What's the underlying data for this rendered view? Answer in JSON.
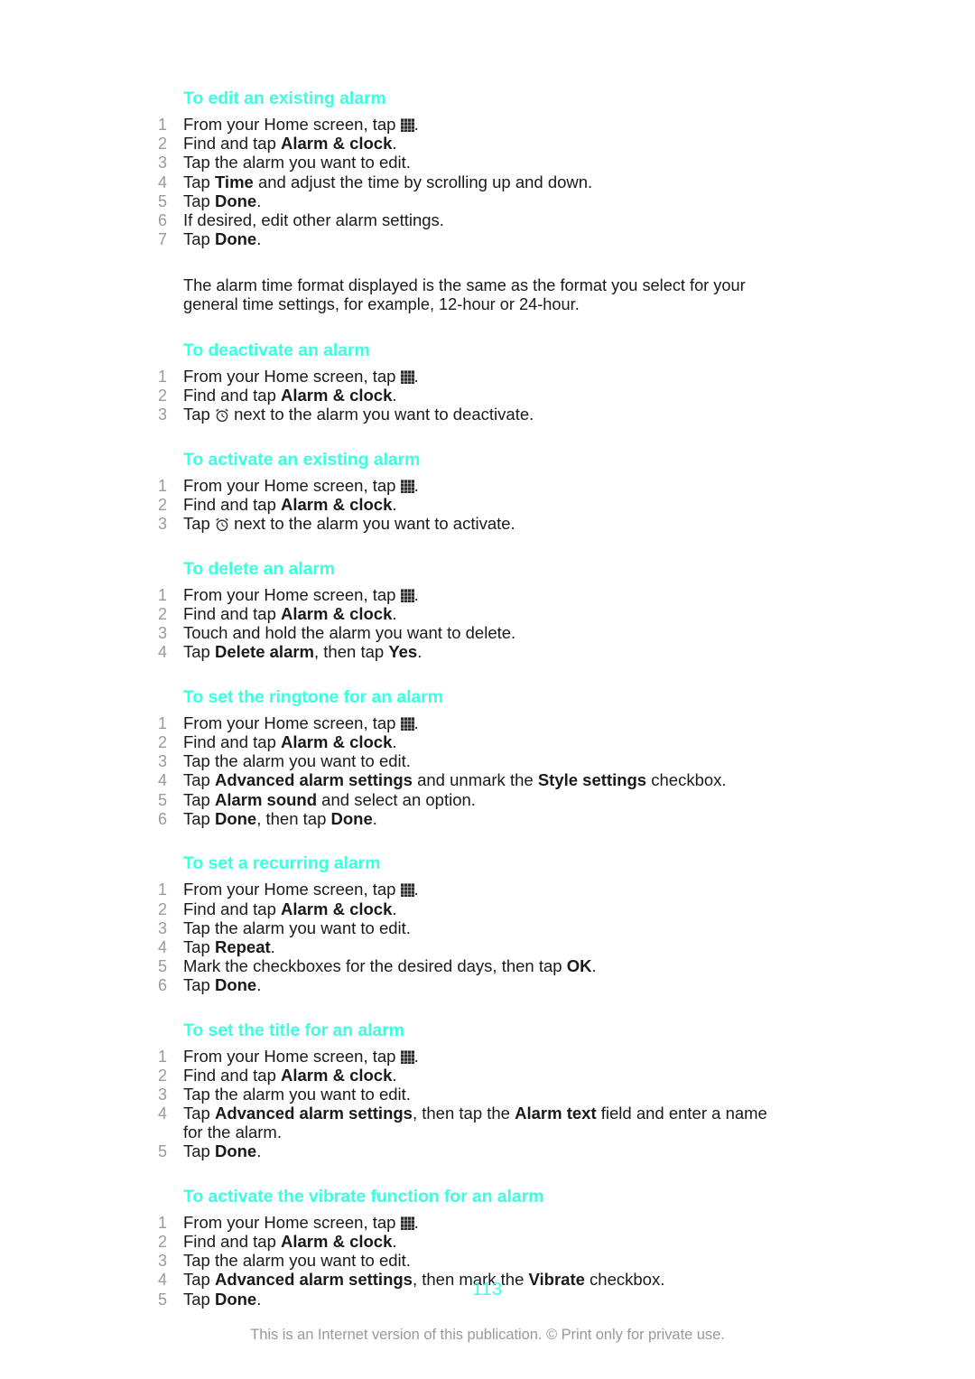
{
  "document": {
    "page_number": "113",
    "footer_note": "This is an Internet version of this publication. © Print only for private use.",
    "accent_color": "#3dffe0",
    "number_color": "#9a9a9a",
    "text_color": "#1a1a1a"
  },
  "icons": {
    "app_drawer": "app-drawer-icon",
    "alarm_clock": "alarm-clock-icon"
  },
  "sections": [
    {
      "heading": "To edit an existing alarm",
      "steps": [
        {
          "num": "1",
          "parts": [
            {
              "t": "From your Home screen, tap "
            },
            {
              "icon": "app-drawer"
            },
            {
              "t": "."
            }
          ]
        },
        {
          "num": "2",
          "parts": [
            {
              "t": "Find and tap "
            },
            {
              "t": "Alarm & clock",
              "bold": true
            },
            {
              "t": "."
            }
          ]
        },
        {
          "num": "3",
          "parts": [
            {
              "t": "Tap the alarm you want to edit."
            }
          ]
        },
        {
          "num": "4",
          "parts": [
            {
              "t": "Tap "
            },
            {
              "t": "Time",
              "bold": true
            },
            {
              "t": " and adjust the time by scrolling up and down."
            }
          ]
        },
        {
          "num": "5",
          "parts": [
            {
              "t": "Tap "
            },
            {
              "t": "Done",
              "bold": true
            },
            {
              "t": "."
            }
          ]
        },
        {
          "num": "6",
          "parts": [
            {
              "t": "If desired, edit other alarm settings."
            }
          ]
        },
        {
          "num": "7",
          "parts": [
            {
              "t": "Tap "
            },
            {
              "t": "Done",
              "bold": true
            },
            {
              "t": "."
            }
          ]
        }
      ],
      "note": "The alarm time format displayed is the same as the format you select for your general time settings, for example, 12-hour or 24-hour."
    },
    {
      "heading": "To deactivate an alarm",
      "steps": [
        {
          "num": "1",
          "parts": [
            {
              "t": "From your Home screen, tap "
            },
            {
              "icon": "app-drawer"
            },
            {
              "t": "."
            }
          ]
        },
        {
          "num": "2",
          "parts": [
            {
              "t": "Find and tap "
            },
            {
              "t": "Alarm & clock",
              "bold": true
            },
            {
              "t": "."
            }
          ]
        },
        {
          "num": "3",
          "parts": [
            {
              "t": "Tap "
            },
            {
              "icon": "alarm-clock"
            },
            {
              "t": " next to the alarm you want to deactivate."
            }
          ]
        }
      ]
    },
    {
      "heading": "To activate an existing alarm",
      "steps": [
        {
          "num": "1",
          "parts": [
            {
              "t": "From your Home screen, tap "
            },
            {
              "icon": "app-drawer"
            },
            {
              "t": "."
            }
          ]
        },
        {
          "num": "2",
          "parts": [
            {
              "t": "Find and tap "
            },
            {
              "t": "Alarm & clock",
              "bold": true
            },
            {
              "t": "."
            }
          ]
        },
        {
          "num": "3",
          "parts": [
            {
              "t": "Tap "
            },
            {
              "icon": "alarm-clock"
            },
            {
              "t": " next to the alarm you want to activate."
            }
          ]
        }
      ]
    },
    {
      "heading": "To delete an alarm",
      "steps": [
        {
          "num": "1",
          "parts": [
            {
              "t": "From your Home screen, tap "
            },
            {
              "icon": "app-drawer"
            },
            {
              "t": "."
            }
          ]
        },
        {
          "num": "2",
          "parts": [
            {
              "t": "Find and tap "
            },
            {
              "t": "Alarm & clock",
              "bold": true
            },
            {
              "t": "."
            }
          ]
        },
        {
          "num": "3",
          "parts": [
            {
              "t": "Touch and hold the alarm you want to delete."
            }
          ]
        },
        {
          "num": "4",
          "parts": [
            {
              "t": "Tap "
            },
            {
              "t": "Delete alarm",
              "bold": true
            },
            {
              "t": ", then tap "
            },
            {
              "t": "Yes",
              "bold": true
            },
            {
              "t": "."
            }
          ]
        }
      ]
    },
    {
      "heading": "To set the ringtone for an alarm",
      "steps": [
        {
          "num": "1",
          "parts": [
            {
              "t": "From your Home screen, tap "
            },
            {
              "icon": "app-drawer"
            },
            {
              "t": "."
            }
          ]
        },
        {
          "num": "2",
          "parts": [
            {
              "t": "Find and tap "
            },
            {
              "t": "Alarm & clock",
              "bold": true
            },
            {
              "t": "."
            }
          ]
        },
        {
          "num": "3",
          "parts": [
            {
              "t": "Tap the alarm you want to edit."
            }
          ]
        },
        {
          "num": "4",
          "parts": [
            {
              "t": "Tap "
            },
            {
              "t": "Advanced alarm settings",
              "bold": true
            },
            {
              "t": " and unmark the "
            },
            {
              "t": "Style settings",
              "bold": true
            },
            {
              "t": " checkbox."
            }
          ]
        },
        {
          "num": "5",
          "parts": [
            {
              "t": "Tap "
            },
            {
              "t": "Alarm sound",
              "bold": true
            },
            {
              "t": " and select an option."
            }
          ]
        },
        {
          "num": "6",
          "parts": [
            {
              "t": "Tap "
            },
            {
              "t": "Done",
              "bold": true
            },
            {
              "t": ", then tap "
            },
            {
              "t": "Done",
              "bold": true
            },
            {
              "t": "."
            }
          ]
        }
      ]
    },
    {
      "heading": "To set a recurring alarm",
      "steps": [
        {
          "num": "1",
          "parts": [
            {
              "t": "From your Home screen, tap "
            },
            {
              "icon": "app-drawer"
            },
            {
              "t": "."
            }
          ]
        },
        {
          "num": "2",
          "parts": [
            {
              "t": "Find and tap "
            },
            {
              "t": "Alarm & clock",
              "bold": true
            },
            {
              "t": "."
            }
          ]
        },
        {
          "num": "3",
          "parts": [
            {
              "t": "Tap the alarm you want to edit."
            }
          ]
        },
        {
          "num": "4",
          "parts": [
            {
              "t": "Tap "
            },
            {
              "t": "Repeat",
              "bold": true
            },
            {
              "t": "."
            }
          ]
        },
        {
          "num": "5",
          "parts": [
            {
              "t": "Mark the checkboxes for the desired days, then tap "
            },
            {
              "t": "OK",
              "bold": true
            },
            {
              "t": "."
            }
          ]
        },
        {
          "num": "6",
          "parts": [
            {
              "t": "Tap "
            },
            {
              "t": "Done",
              "bold": true
            },
            {
              "t": "."
            }
          ]
        }
      ]
    },
    {
      "heading": "To set the title for an alarm",
      "steps": [
        {
          "num": "1",
          "parts": [
            {
              "t": "From your Home screen, tap "
            },
            {
              "icon": "app-drawer"
            },
            {
              "t": "."
            }
          ]
        },
        {
          "num": "2",
          "parts": [
            {
              "t": "Find and tap "
            },
            {
              "t": "Alarm & clock",
              "bold": true
            },
            {
              "t": "."
            }
          ]
        },
        {
          "num": "3",
          "parts": [
            {
              "t": "Tap the alarm you want to edit."
            }
          ]
        },
        {
          "num": "4",
          "parts": [
            {
              "t": "Tap "
            },
            {
              "t": "Advanced alarm settings",
              "bold": true
            },
            {
              "t": ", then tap the "
            },
            {
              "t": "Alarm text",
              "bold": true
            },
            {
              "t": " field and enter a name for the alarm."
            }
          ]
        },
        {
          "num": "5",
          "parts": [
            {
              "t": "Tap "
            },
            {
              "t": "Done",
              "bold": true
            },
            {
              "t": "."
            }
          ]
        }
      ]
    },
    {
      "heading": "To activate the vibrate function for an alarm",
      "steps": [
        {
          "num": "1",
          "parts": [
            {
              "t": "From your Home screen, tap "
            },
            {
              "icon": "app-drawer"
            },
            {
              "t": "."
            }
          ]
        },
        {
          "num": "2",
          "parts": [
            {
              "t": "Find and tap "
            },
            {
              "t": "Alarm & clock",
              "bold": true
            },
            {
              "t": "."
            }
          ]
        },
        {
          "num": "3",
          "parts": [
            {
              "t": "Tap the alarm you want to edit."
            }
          ]
        },
        {
          "num": "4",
          "parts": [
            {
              "t": "Tap "
            },
            {
              "t": "Advanced alarm settings",
              "bold": true
            },
            {
              "t": ", then mark the "
            },
            {
              "t": "Vibrate",
              "bold": true
            },
            {
              "t": " checkbox."
            }
          ]
        },
        {
          "num": "5",
          "parts": [
            {
              "t": "Tap "
            },
            {
              "t": "Done",
              "bold": true
            },
            {
              "t": "."
            }
          ]
        }
      ]
    }
  ]
}
